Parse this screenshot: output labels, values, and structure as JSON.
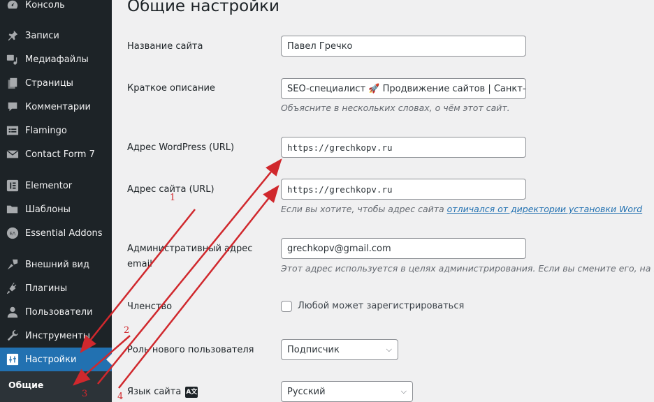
{
  "sidebar": {
    "items": [
      {
        "label": "Консоль",
        "icon": "dashboard-icon"
      },
      {
        "label": "Записи",
        "icon": "pin-icon"
      },
      {
        "label": "Медиафайлы",
        "icon": "media-icon"
      },
      {
        "label": "Страницы",
        "icon": "pages-icon"
      },
      {
        "label": "Комментарии",
        "icon": "comment-icon"
      },
      {
        "label": "Flamingo",
        "icon": "flamingo-icon"
      },
      {
        "label": "Contact Form 7",
        "icon": "mail-icon"
      },
      {
        "label": "Elementor",
        "icon": "elementor-icon"
      },
      {
        "label": "Шаблоны",
        "icon": "folder-icon"
      },
      {
        "label": "Essential Addons",
        "icon": "ea-icon"
      },
      {
        "label": "Внешний вид",
        "icon": "brush-icon"
      },
      {
        "label": "Плагины",
        "icon": "plugin-icon"
      },
      {
        "label": "Пользователи",
        "icon": "user-icon"
      },
      {
        "label": "Инструменты",
        "icon": "wrench-icon"
      },
      {
        "label": "Настройки",
        "icon": "settings-sliders-icon",
        "active": true
      }
    ],
    "submenu": {
      "label": "Общие"
    },
    "colors": {
      "bg": "#1d2327",
      "active": "#2271b1"
    }
  },
  "main": {
    "title": "Общие настройки",
    "site_title": {
      "label": "Название сайта",
      "value": "Павел Гречко"
    },
    "tagline": {
      "label": "Краткое описание",
      "value": "SEO-специалист 🚀 Продвижение сайтов | Санкт-П",
      "description": "Объясните в нескольких словах, о чём этот сайт."
    },
    "wp_url": {
      "label": "Адрес WordPress (URL)",
      "value": "https://grechkopv.ru"
    },
    "site_url": {
      "label": "Адрес сайта (URL)",
      "value": "https://grechkopv.ru",
      "description_prefix": "Если вы хотите, чтобы адрес сайта ",
      "description_link": "отличался от директории установки Word"
    },
    "admin_email": {
      "label": "Административный адрес email",
      "value": "grechkopv@gmail.com",
      "description": "Этот адрес используется в целях администрирования. Если вы смените его, на н"
    },
    "membership": {
      "label": "Членство",
      "checkbox_label": "Любой может зарегистрироваться",
      "checked": false
    },
    "default_role": {
      "label": "Роль нового пользователя",
      "value": "Подписчик"
    },
    "site_language": {
      "label": "Язык сайта",
      "value": "Русский"
    }
  },
  "annotations": {
    "labels": [
      "1",
      "2",
      "3",
      "4"
    ],
    "color": "#d0282d"
  }
}
